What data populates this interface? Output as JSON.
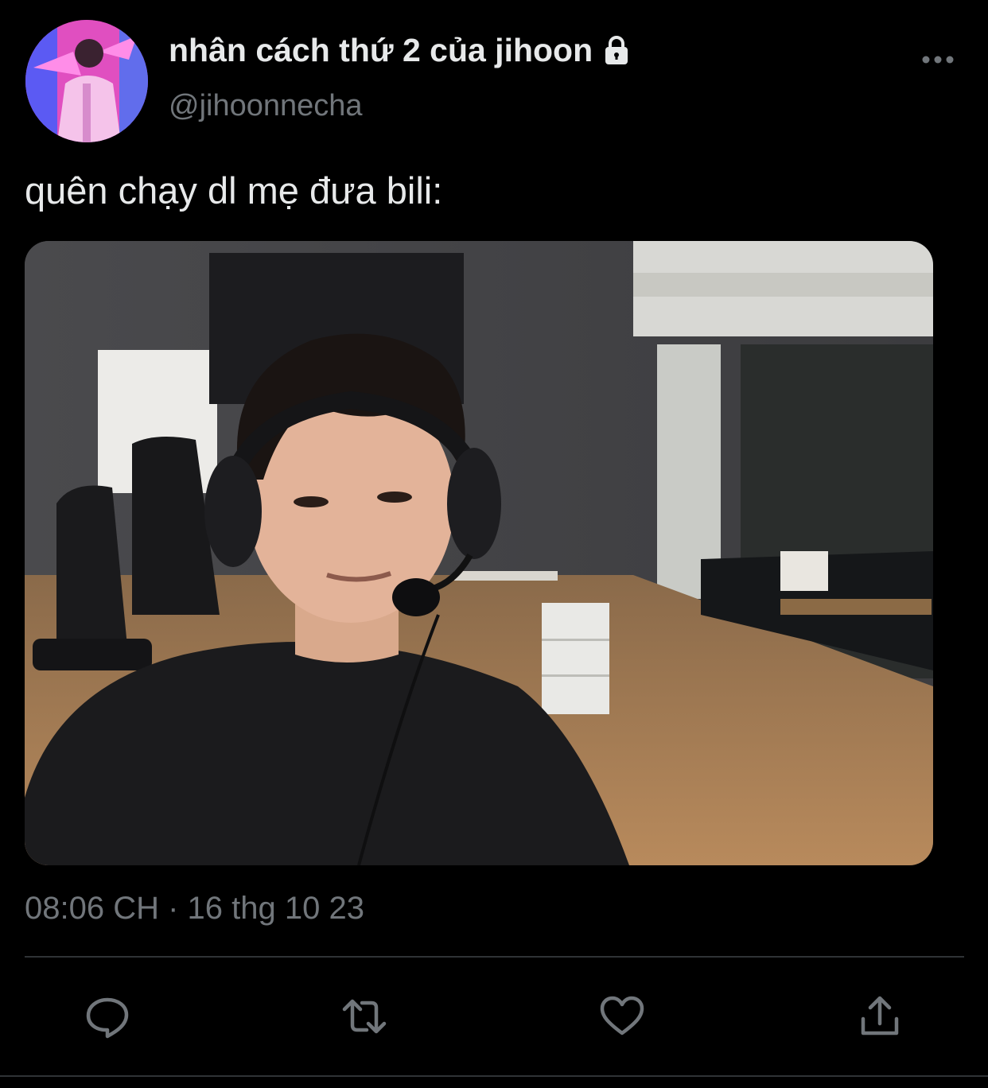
{
  "author": {
    "display_name": "nhân cách thứ 2 của jihoon",
    "handle": "@jihoonnecha",
    "protected_icon": "lock-icon",
    "avatar_icon": "avatar"
  },
  "tweet": {
    "text": "quên chạy dl mẹ đưa bili:",
    "timestamp": "08:06 CH · 16 thg 10 23"
  },
  "media": {
    "description_icon": "webcam-photo"
  },
  "actions": {
    "reply_icon": "reply-icon",
    "retweet_icon": "retweet-icon",
    "like_icon": "heart-icon",
    "share_icon": "share-icon",
    "more_icon": "more-dots-icon"
  },
  "colors": {
    "background": "#000000",
    "text_primary": "#e7e9ea",
    "text_secondary": "#71767b",
    "divider": "#2f3336"
  }
}
